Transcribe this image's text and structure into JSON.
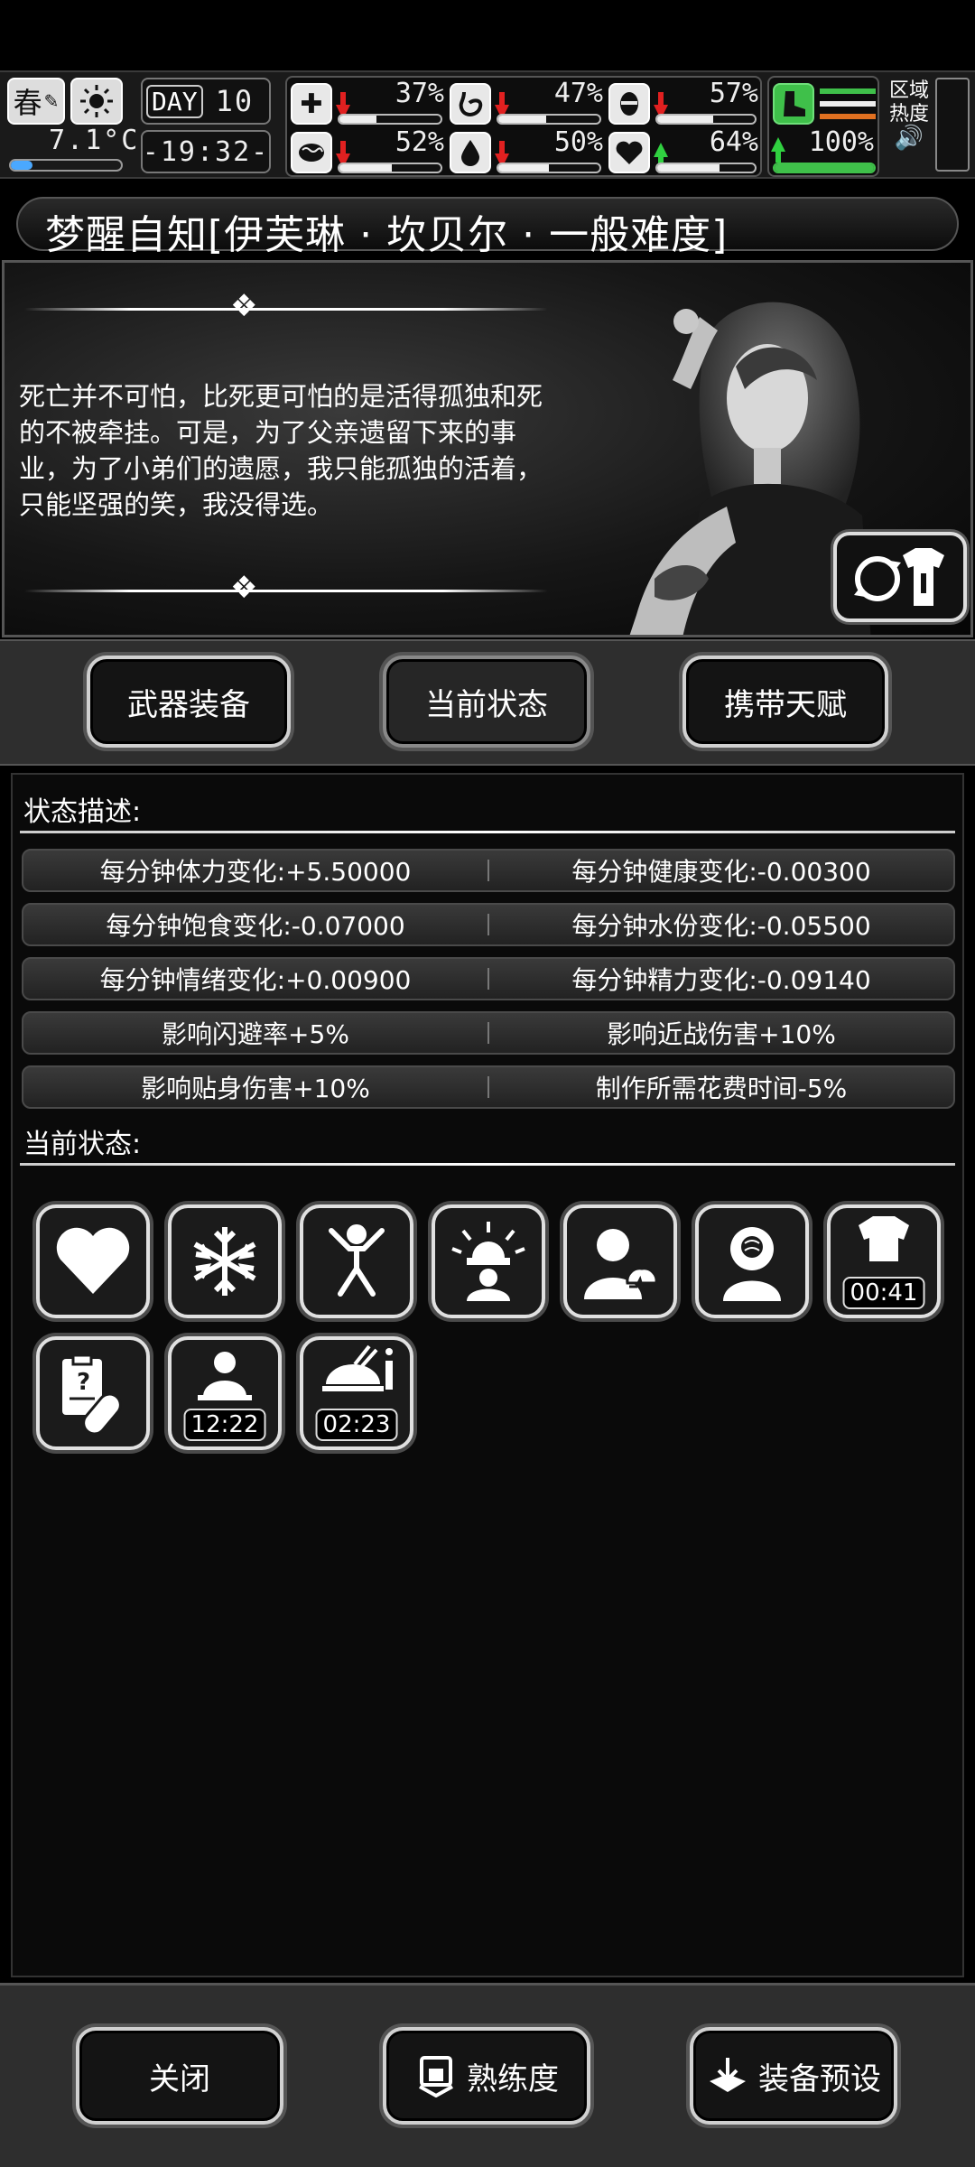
{
  "hud": {
    "season": "春",
    "day_label": "DAY",
    "day": "10",
    "temperature": "7.1°C",
    "time": "-19:32-",
    "stats": [
      {
        "name": "health",
        "icon": "medkit-icon",
        "value": "37%",
        "level": 0.37,
        "trend": "down"
      },
      {
        "name": "hunger",
        "icon": "stomach-icon",
        "value": "47%",
        "level": 0.47,
        "trend": "down"
      },
      {
        "name": "stamina",
        "icon": "face-icon",
        "value": "57%",
        "level": 0.57,
        "trend": "down"
      },
      {
        "name": "mood",
        "icon": "brain-icon",
        "value": "52%",
        "level": 0.52,
        "trend": "down"
      },
      {
        "name": "water",
        "icon": "water-drop-icon",
        "value": "50%",
        "level": 0.5,
        "trend": "down"
      },
      {
        "name": "heart",
        "icon": "heart-icon",
        "value": "64%",
        "level": 0.64,
        "trend": "up"
      },
      {
        "name": "energy",
        "icon": "boot-icon",
        "value": "100%",
        "level": 1.0,
        "trend": "up"
      }
    ],
    "zone_heat_label_1": "区域",
    "zone_heat_label_2": "热度",
    "colors": {
      "down": "#e02020",
      "up": "#30d040",
      "energy": "#3fc04a"
    }
  },
  "title": "梦醒自知[伊芙琳 · 坎贝尔 · 一般难度]",
  "quote": "死亡并不可怕，比死更可怕的是活得孤独和死的不被牵挂。可是，为了父亲遗留下来的事业，为了小弟们的遗愿，我只能孤独的活着，只能坚强的笑，我没得选。",
  "tabs": [
    {
      "label": "武器装备",
      "active": false
    },
    {
      "label": "当前状态",
      "active": true
    },
    {
      "label": "携带天赋",
      "active": false
    }
  ],
  "status_desc_label": "状态描述:",
  "stat_rows": [
    [
      "每分钟体力变化:+5.50000",
      "每分钟健康变化:-0.00300"
    ],
    [
      "每分钟饱食变化:-0.07000",
      "每分钟水份变化:-0.05500"
    ],
    [
      "每分钟情绪变化:+0.00900",
      "每分钟精力变化:-0.09140"
    ],
    [
      "影响闪避率+5%",
      "影响近战伤害+10%"
    ],
    [
      "影响贴身伤害+10%",
      "制作所需花费时间-5%"
    ]
  ],
  "current_status_label": "当前状态:",
  "status_icons": [
    {
      "icon": "heart-icon",
      "timer": ""
    },
    {
      "icon": "snowflake-icon",
      "timer": ""
    },
    {
      "icon": "stretch-figure-icon",
      "timer": ""
    },
    {
      "icon": "alarm-light-icon",
      "timer": ""
    },
    {
      "icon": "person-heartbeat-icon",
      "timer": ""
    },
    {
      "icon": "head-brain-icon",
      "timer": ""
    },
    {
      "icon": "shirt-icon",
      "timer": "00:41"
    },
    {
      "icon": "medicine-clipboard-icon",
      "timer": ""
    },
    {
      "icon": "person-studying-icon",
      "timer": "12:22"
    },
    {
      "icon": "meal-icon",
      "timer": "02:23"
    }
  ],
  "bottom": {
    "close": "关闭",
    "proficiency": "熟练度",
    "equipment_preset": "装备预设"
  }
}
